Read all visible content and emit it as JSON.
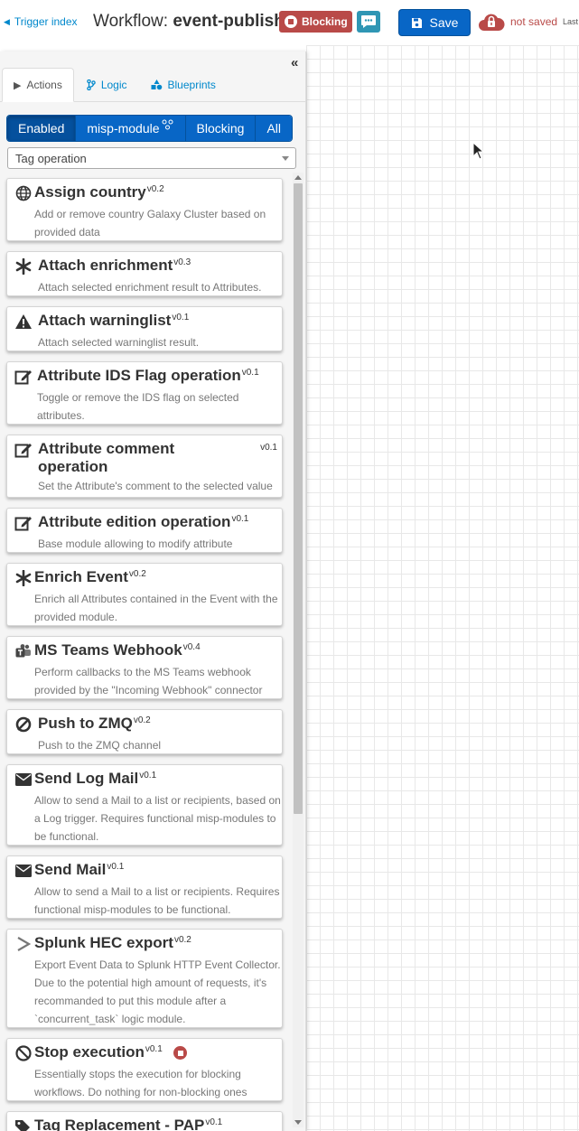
{
  "header": {
    "trigger_link": "Trigger index",
    "title_prefix": "Workflow: ",
    "title_name": "event-publish",
    "blocking_badge": "Blocking",
    "save_label": "Save",
    "status": "not saved",
    "last_text": "Last",
    "colors": {
      "blocking": "#b94a48",
      "primary": "#0866c6",
      "info": "#2f96b4"
    }
  },
  "sidebar": {
    "collapse_glyph": "«",
    "tabs": [
      {
        "label": "Actions",
        "icon": "play-icon"
      },
      {
        "label": "Logic",
        "icon": "code-branch-icon"
      },
      {
        "label": "Blueprints",
        "icon": "shapes-icon"
      }
    ],
    "filters": [
      {
        "label": "Enabled"
      },
      {
        "label": "misp-module"
      },
      {
        "label": "Blocking"
      },
      {
        "label": "All"
      }
    ],
    "select_value": "Tag operation"
  },
  "modules": [
    {
      "name": "Assign country",
      "version": "v0.2",
      "icon": "globe-icon",
      "desc": [
        "Add or remove country Galaxy Cluster based on",
        "provided data"
      ]
    },
    {
      "name": "Attach enrichment",
      "version": "v0.3",
      "icon": "asterisk-icon",
      "desc": [
        "Attach selected enrichment result to Attributes."
      ]
    },
    {
      "name": "Attach warninglist",
      "version": "v0.1",
      "icon": "warning-icon",
      "desc": [
        "Attach selected warninglist result."
      ]
    },
    {
      "name": "Attribute IDS Flag operation",
      "version": "v0.1",
      "icon": "edit-icon",
      "desc": [
        "Toggle or remove the IDS flag on selected",
        "attributes."
      ]
    },
    {
      "name": "Attribute comment\noperation",
      "version": "v0.1",
      "icon": "edit-icon",
      "desc": [
        "Set the Attribute's comment to the selected value"
      ]
    },
    {
      "name": "Attribute edition operation",
      "version": "v0.1",
      "icon": "edit-icon",
      "desc": [
        "Base module allowing to modify attribute"
      ]
    },
    {
      "name": "Enrich Event",
      "version": "v0.2",
      "icon": "asterisk-icon",
      "desc": [
        "Enrich all Attributes contained in the Event with the",
        "provided module."
      ]
    },
    {
      "name": "MS Teams Webhook",
      "version": "v0.4",
      "icon": "teams-icon",
      "desc": [
        "Perform callbacks to the MS Teams webhook",
        "provided by the \"Incoming Webhook\" connector"
      ]
    },
    {
      "name": "Push to ZMQ",
      "version": "v0.2",
      "icon": "zmq-icon",
      "desc": [
        "Push to the ZMQ channel"
      ]
    },
    {
      "name": "Send Log Mail",
      "version": "v0.1",
      "icon": "envelope-icon",
      "desc": [
        "Allow to send a Mail to a list or recipients, based on",
        "a Log trigger. Requires functional misp-modules to",
        "be functional."
      ]
    },
    {
      "name": "Send Mail",
      "version": "v0.1",
      "icon": "envelope-icon",
      "desc": [
        "Allow to send a Mail to a list or recipients. Requires",
        "functional misp-modules to be functional."
      ]
    },
    {
      "name": "Splunk HEC export",
      "version": "v0.2",
      "icon": "chevron-right-icon",
      "desc": [
        "Export Event Data to Splunk HTTP Event Collector.",
        "Due to the potential high amount of requests, it's",
        "recommanded to put this module after a",
        "`concurrent_task` logic module."
      ]
    },
    {
      "name": "Stop execution",
      "version": "v0.1",
      "icon": "ban-icon",
      "desc": [
        "Essentially stops the execution for blocking",
        "workflows. Do nothing for non-blocking ones"
      ]
    },
    {
      "name": "Tag Replacement - PAP",
      "version": "v0.1",
      "icon": "tags-icon",
      "desc": []
    }
  ]
}
